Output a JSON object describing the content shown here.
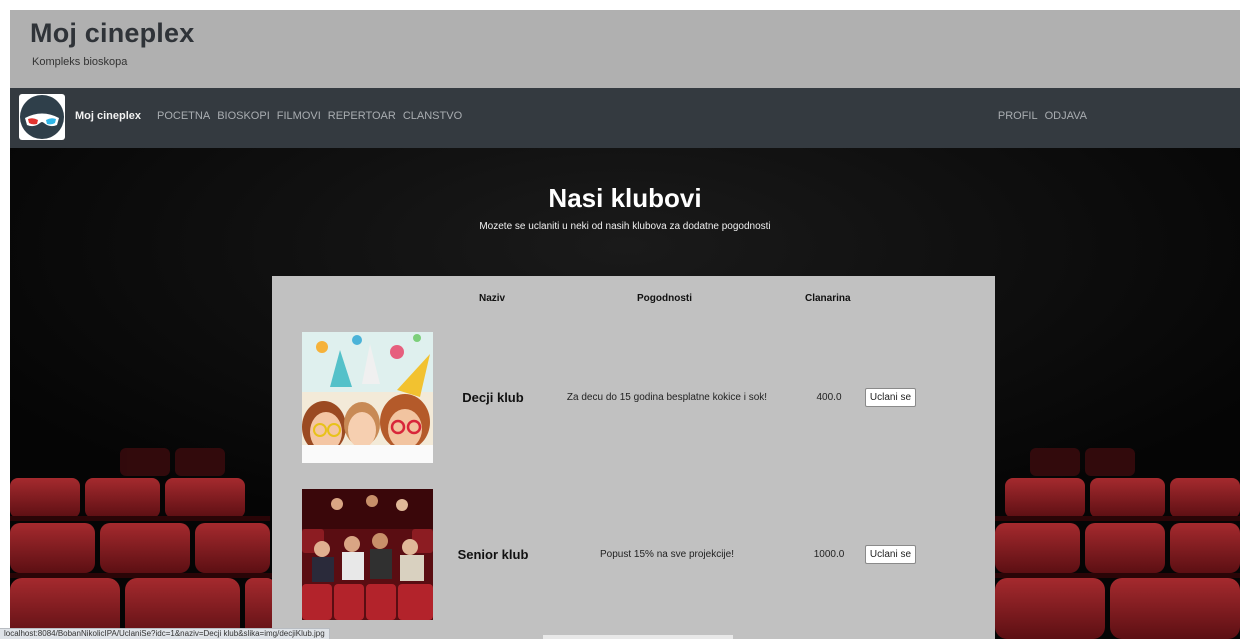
{
  "header": {
    "title": "Moj cineplex",
    "subtitle": "Kompleks bioskopa"
  },
  "navbar": {
    "brand": "Moj cineplex",
    "logo_icon": "3d-glasses-icon",
    "links": [
      "POCETNA",
      "BIOSKOPI",
      "FILMOVI",
      "REPERTOAR",
      "CLANSTVO"
    ],
    "right_links": [
      "PROFIL",
      "ODJAVA"
    ]
  },
  "hero": {
    "title": "Nasi klubovi",
    "subtitle": "Mozete se uclaniti u neki od nasih klubova za dodatne pogodnosti"
  },
  "table": {
    "headers": {
      "naziv": "Naziv",
      "pogodnosti": "Pogodnosti",
      "clanarina": "Clanarina"
    },
    "rows": [
      {
        "name": "Decji klub",
        "benefit": "Za decu do 15 godina besplatne kokice i sok!",
        "fee": "400.0",
        "button": "Uclani se",
        "image": "children-party-photo"
      },
      {
        "name": "Senior klub",
        "benefit": "Popust 15% na sve projekcije!",
        "fee": "1000.0",
        "button": "Uclani se",
        "image": "cinema-audience-photo"
      }
    ]
  },
  "status_bar": {
    "url": "localhost:8084/BobanNikolicIPA/UclaniSe?idc=1&naziv=Decji klub&slika=img/decjiKlub.jpg"
  },
  "colors": {
    "header_bg": "#b0b0b0",
    "navbar_bg": "#343a40",
    "panel_bg": "#c1c1c1",
    "seat_red": "#8e1a1f"
  }
}
